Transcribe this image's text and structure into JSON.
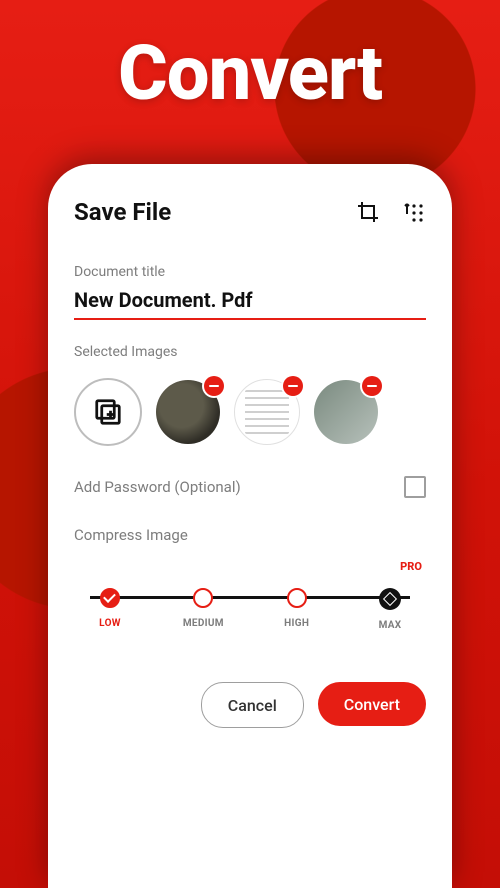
{
  "hero": "Convert",
  "header": {
    "title": "Save File"
  },
  "document": {
    "label": "Document title",
    "value": "New Document. Pdf"
  },
  "selected_images": {
    "label": "Selected Images"
  },
  "password": {
    "label": "Add Password (Optional)",
    "checked": false
  },
  "compress": {
    "label": "Compress Image",
    "pro_tag": "PRO",
    "selected_index": 0,
    "options": [
      {
        "label": "LOW"
      },
      {
        "label": "MEDIUM"
      },
      {
        "label": "HIGH"
      },
      {
        "label": "MAX"
      }
    ]
  },
  "actions": {
    "cancel": "Cancel",
    "convert": "Convert"
  },
  "colors": {
    "accent": "#e61e14"
  }
}
